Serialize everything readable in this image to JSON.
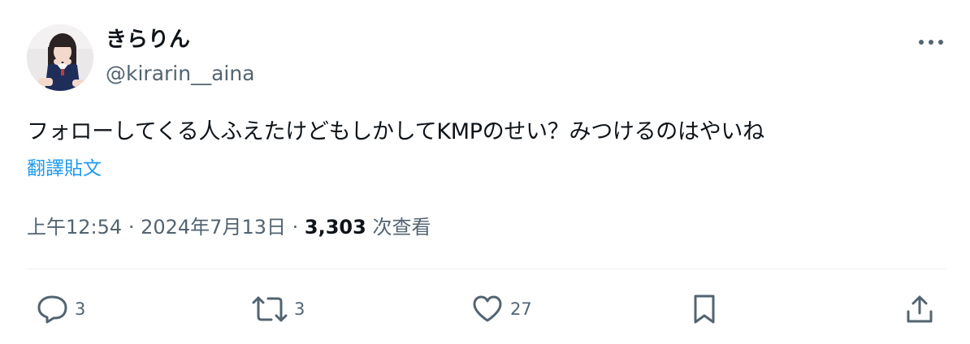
{
  "author": {
    "display_name": "きらりん",
    "handle": "@kirarin__aina"
  },
  "tweet": {
    "text": "フォローしてくる人ふえたけどもしかしてKMPのせい？みつけるのはやいね",
    "translate_label": "翻譯貼文",
    "time": "上午12:54",
    "separator": "·",
    "date": "2024年7月13日",
    "views_count": "3,303",
    "views_label": "次查看"
  },
  "actions": {
    "replies": "3",
    "reposts": "3",
    "likes": "27"
  },
  "icons": {
    "more": "more-horizontal-icon",
    "reply": "reply-bubble-icon",
    "repost": "repost-arrows-icon",
    "like": "heart-icon",
    "bookmark": "bookmark-icon",
    "share": "share-upload-icon"
  },
  "colors": {
    "text": "#0f1419",
    "secondary": "#536471",
    "link": "#1d9bf0",
    "divider": "#eff3f4"
  }
}
